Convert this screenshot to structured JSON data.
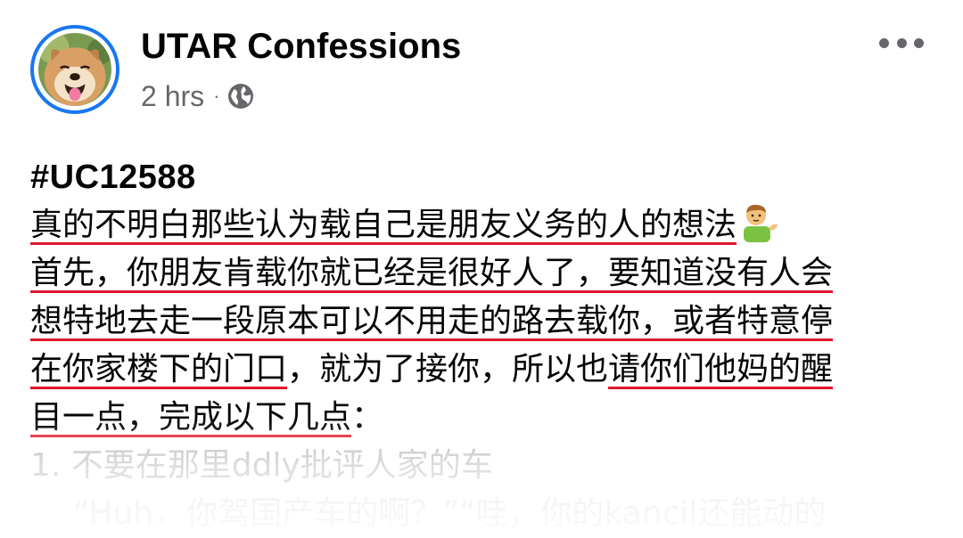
{
  "post": {
    "page_name": "UTAR Confessions",
    "timestamp": "2 hrs",
    "separator": "·",
    "privacy_icon": "globe-icon",
    "more_icon": "more-horizontal-icon",
    "avatar_icon": "dog-face-avatar",
    "accent_color": "#1877f2",
    "underline_color": "#e0182b"
  },
  "body": {
    "hashtag": "#UC12588",
    "line1": "真的不明白那些认为载自己是朋友义务的人的想法",
    "line1_emoji": "man-tipping-hand-emoji",
    "line2": "首先，你朋友肯载你就已经是很好人了，要知道没有人会",
    "line3": "想特地去走一段原本可以不用走的路去载你，或者特意停",
    "line4_underlined": "在你家楼下的门口",
    "line4_plain": "，就为了接你，所以也",
    "line4_underlined2": "请你们他妈的醒",
    "line5_underlined": "目一点，完成以下几点",
    "line5_plain": "：",
    "line6": "1. 不要在那里ddly批评人家的车",
    "line7": "“Huh，你驾国产车的啊？”“哇，你的kancil还能动的"
  }
}
